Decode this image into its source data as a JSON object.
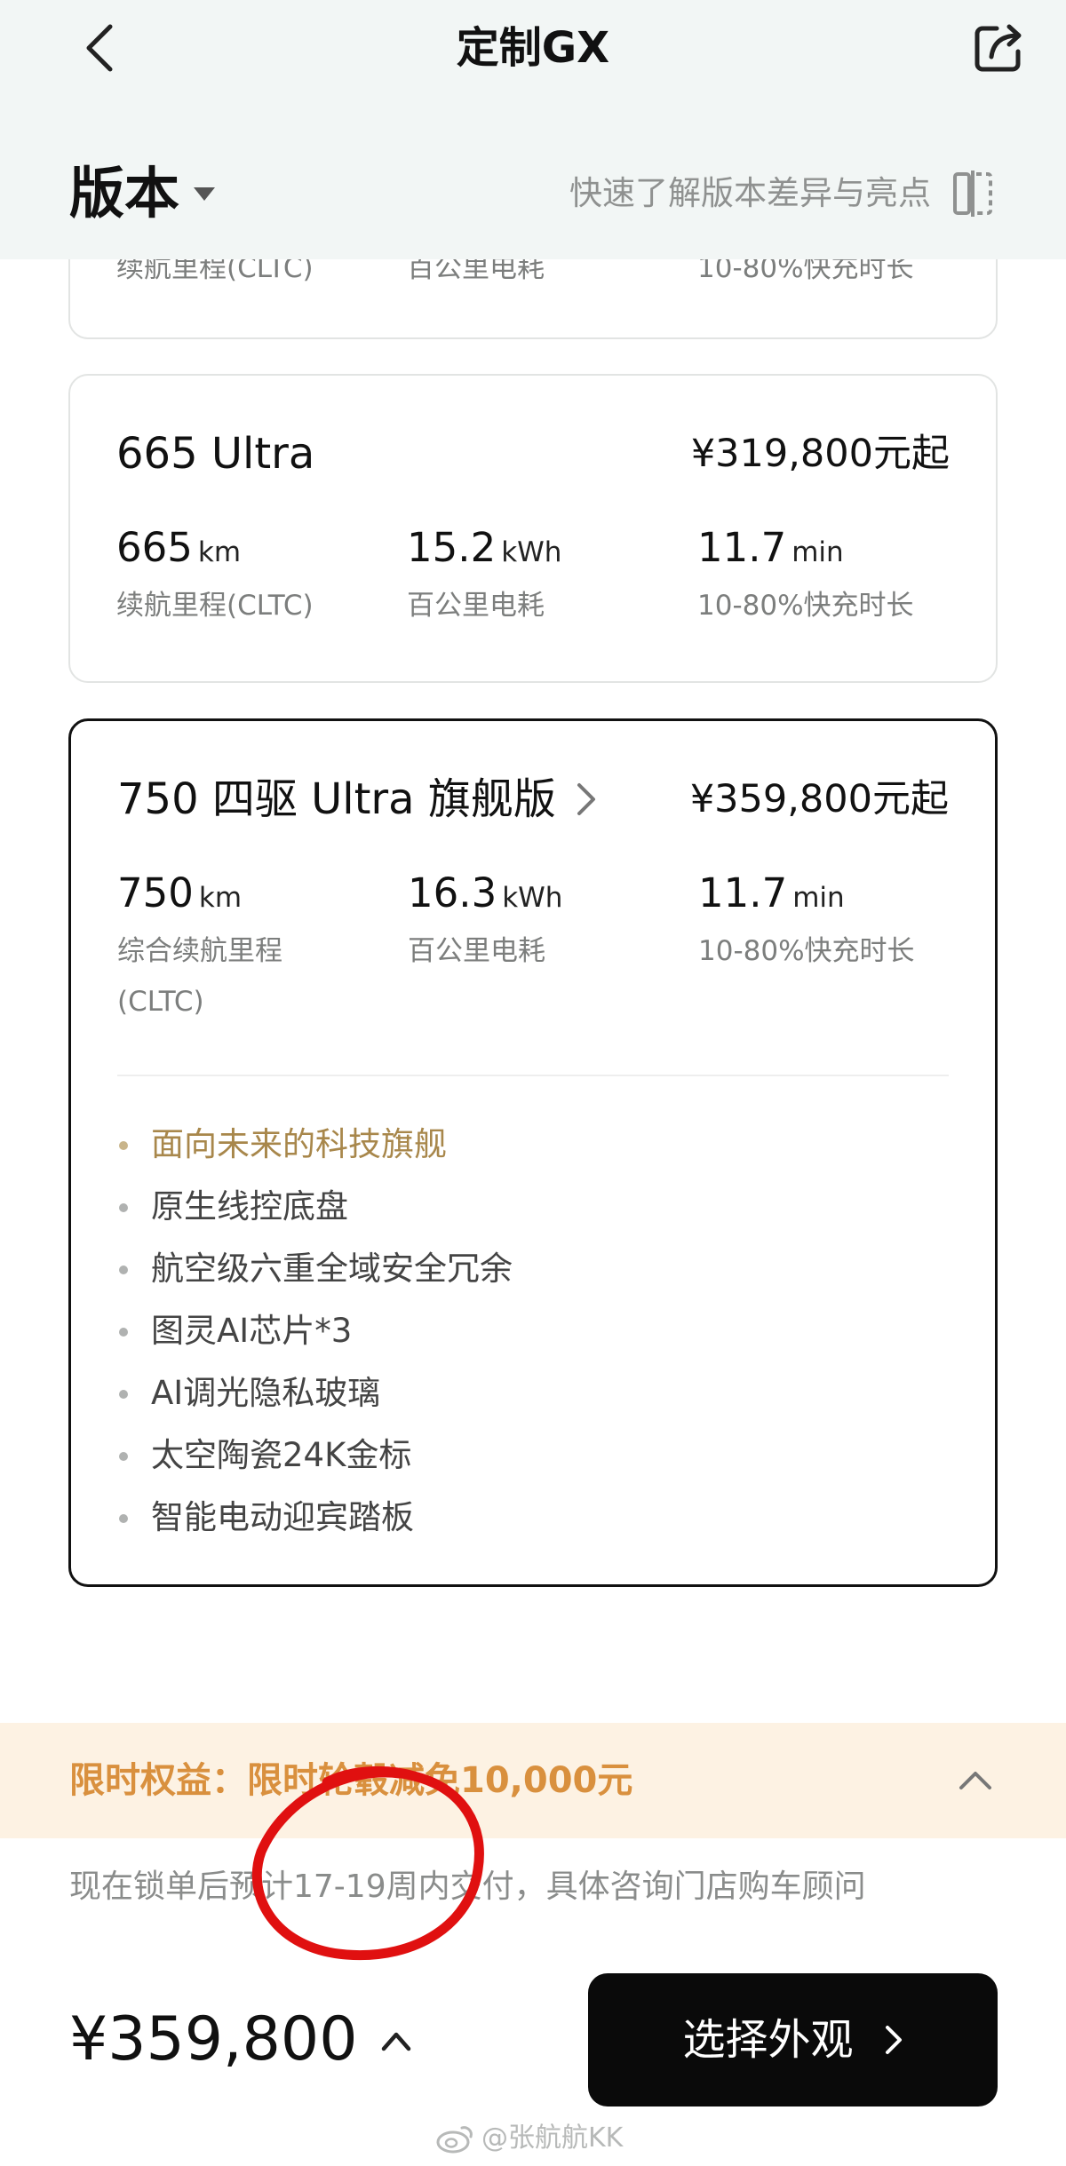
{
  "header": {
    "title": "定制GX",
    "version_tab": "版本",
    "compare_link": "快速了解版本差异与亮点"
  },
  "cards": [
    {
      "specs": [
        {
          "label": "续航里程(CLTC)"
        },
        {
          "label": "百公里电耗"
        },
        {
          "label": "10-80%快充时长"
        }
      ]
    },
    {
      "name": "665 Ultra",
      "price": "¥319,800元起",
      "specs": [
        {
          "value": "665",
          "unit": "km",
          "label": "续航里程(CLTC)"
        },
        {
          "value": "15.2",
          "unit": "kWh",
          "label": "百公里电耗"
        },
        {
          "value": "11.7",
          "unit": "min",
          "label": "10-80%快充时长"
        }
      ]
    },
    {
      "name": "750 四驱 Ultra 旗舰版",
      "price": "¥359,800元起",
      "selected": true,
      "specs": [
        {
          "value": "750",
          "unit": "km",
          "label": "综合续航里程(CLTC)"
        },
        {
          "value": "16.3",
          "unit": "kWh",
          "label": "百公里电耗"
        },
        {
          "value": "11.7",
          "unit": "min",
          "label": "10-80%快充时长"
        }
      ],
      "features": [
        "面向未来的科技旗舰",
        "原生线控底盘",
        "航空级六重全域安全冗余",
        "图灵AI芯片*3",
        "AI调光隐私玻璃",
        "太空陶瓷24K金标",
        "智能电动迎宾踏板"
      ]
    }
  ],
  "promo": {
    "text": "限时权益：限时轮毂减免10,000元"
  },
  "delivery_note": "现在锁单后预计17-19周内交付，具体咨询门店购车顾问",
  "bottom_bar": {
    "total_price": "¥359,800",
    "cta_label": "选择外观"
  },
  "watermark": "@张航航KK",
  "colors": {
    "header_bg": "#f2f6f5",
    "promo_bg": "#fdf2e3",
    "promo_text": "#d9903e",
    "highlight_feature": "#a8874b",
    "cta_bg": "#0a0a0a",
    "annotation_red": "#e01010"
  },
  "icons": {
    "back": "chevron-left-icon",
    "share": "share-icon",
    "compare": "compare-icon",
    "version_caret": "caret-down-icon",
    "promo_toggle": "chevron-up-icon",
    "cta_arrow": "chevron-right-icon"
  }
}
